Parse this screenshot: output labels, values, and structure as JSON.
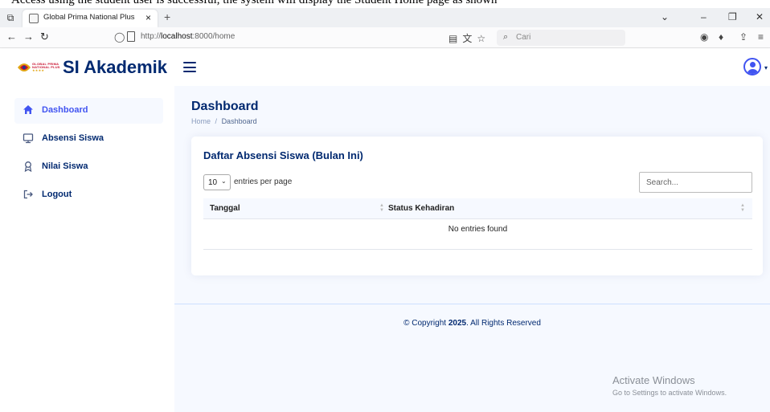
{
  "document": {
    "caption": "Access using the student user is successful, the system will display the Student Home page as shown"
  },
  "browser": {
    "tab_title": "Global Prima National Plus",
    "tab_close": "×",
    "new_tab": "+",
    "url_prefix": "http://",
    "url_host": "localhost",
    "url_path": ":8000/home",
    "search_placeholder": "Cari",
    "icons": [
      "tab-list-icon",
      "back-icon",
      "forward-icon",
      "reload-icon",
      "shield-icon",
      "page-icon",
      "reader-icon",
      "translate-icon",
      "bookmark-star-icon",
      "search-icon",
      "account-icon",
      "extension-icon",
      "share-icon",
      "menu-icon",
      "minimize-icon",
      "maximize-icon",
      "close-icon",
      "chevron-down-icon"
    ]
  },
  "header": {
    "logo_line1": "GLOBAL PRIMA",
    "logo_line2": "NATIONAL PLUS",
    "logo_stars": "★★★★",
    "brand": "SI Akademik"
  },
  "sidebar": {
    "items": [
      {
        "label": "Dashboard",
        "icon": "home-icon",
        "active": true
      },
      {
        "label": "Absensi Siswa",
        "icon": "monitor-icon",
        "active": false
      },
      {
        "label": "Nilai Siswa",
        "icon": "award-icon",
        "active": false
      },
      {
        "label": "Logout",
        "icon": "logout-icon",
        "active": false
      }
    ]
  },
  "main": {
    "page_title": "Dashboard",
    "breadcrumb": {
      "home": "Home",
      "separator": "/",
      "current": "Dashboard"
    }
  },
  "card": {
    "title": "Daftar Absensi Siswa (Bulan Ini)",
    "per_page_value": "10",
    "per_page_label": "entries per page",
    "search_placeholder": "Search...",
    "columns": [
      "Tanggal",
      "Status Kehadiran"
    ],
    "empty_text": "No entries found"
  },
  "footer": {
    "prefix": "© Copyright ",
    "year": "2025",
    "suffix": ". All Rights Reserved"
  },
  "watermark": {
    "line1": "Activate Windows",
    "line2": "Go to Settings to activate Windows."
  },
  "colors": {
    "brand_navy": "#012970",
    "accent_blue": "#4154f1",
    "main_background": "#f6f9ff",
    "muted": "#899bbd"
  }
}
